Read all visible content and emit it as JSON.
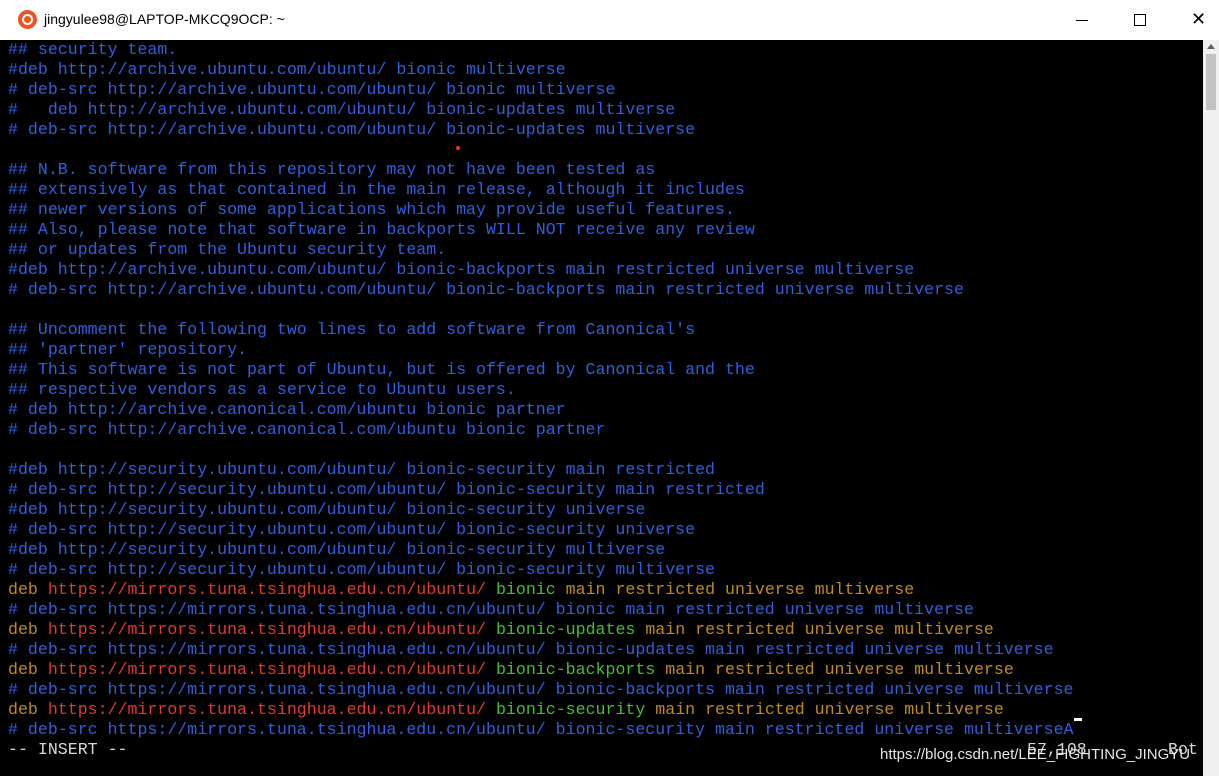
{
  "window": {
    "title": "jingyulee98@LAPTOP-MKCQ9OCP: ~",
    "icon": "ubuntu-icon",
    "controls": {
      "minimize": "minimize-icon",
      "maximize": "maximize-icon",
      "close": "close-icon"
    }
  },
  "colors": {
    "comment": "#2f5fe0",
    "keyword": "#c28a1c",
    "url": "#e33a2a",
    "suite": "#43c12f",
    "background": "#000000"
  },
  "lines": [
    [
      {
        "t": "## security team.",
        "c": "blue"
      }
    ],
    [
      {
        "t": "#deb http://archive.ubuntu.com/ubuntu/ bionic multiverse",
        "c": "blue"
      }
    ],
    [
      {
        "t": "# deb-src http://archive.ubuntu.com/ubuntu/ bionic multiverse",
        "c": "blue"
      }
    ],
    [
      {
        "t": "#   deb http://archive.ubuntu.com/ubuntu/ bionic-updates multiverse",
        "c": "blue"
      }
    ],
    [
      {
        "t": "# deb-src http://archive.ubuntu.com/ubuntu/ bionic-updates multiverse",
        "c": "blue"
      }
    ],
    [],
    [
      {
        "t": "## N.B. software from this repository may not have been tested as",
        "c": "blue"
      }
    ],
    [
      {
        "t": "## extensively as that contained in the main release, although it includes",
        "c": "blue"
      }
    ],
    [
      {
        "t": "## newer versions of some applications which may provide useful features.",
        "c": "blue"
      }
    ],
    [
      {
        "t": "## Also, please note that software in backports WILL NOT receive any review",
        "c": "blue"
      }
    ],
    [
      {
        "t": "## or updates from the Ubuntu security team.",
        "c": "blue"
      }
    ],
    [
      {
        "t": "#deb http://archive.ubuntu.com/ubuntu/ bionic-backports main restricted universe multiverse",
        "c": "blue"
      }
    ],
    [
      {
        "t": "# deb-src http://archive.ubuntu.com/ubuntu/ bionic-backports main restricted universe multiverse",
        "c": "blue"
      }
    ],
    [],
    [
      {
        "t": "## Uncomment the following two lines to add software from Canonical's",
        "c": "blue"
      }
    ],
    [
      {
        "t": "## 'partner' repository.",
        "c": "blue"
      }
    ],
    [
      {
        "t": "## This software is not part of Ubuntu, but is offered by Canonical and the",
        "c": "blue"
      }
    ],
    [
      {
        "t": "## respective vendors as a service to Ubuntu users.",
        "c": "blue"
      }
    ],
    [
      {
        "t": "# deb http://archive.canonical.com/ubuntu bionic partner",
        "c": "blue"
      }
    ],
    [
      {
        "t": "# deb-src http://archive.canonical.com/ubuntu bionic partner",
        "c": "blue"
      }
    ],
    [],
    [
      {
        "t": "#deb http://security.ubuntu.com/ubuntu/ bionic-security main restricted",
        "c": "blue"
      }
    ],
    [
      {
        "t": "# deb-src http://security.ubuntu.com/ubuntu/ bionic-security main restricted",
        "c": "blue"
      }
    ],
    [
      {
        "t": "#deb http://security.ubuntu.com/ubuntu/ bionic-security universe",
        "c": "blue"
      }
    ],
    [
      {
        "t": "# deb-src http://security.ubuntu.com/ubuntu/ bionic-security universe",
        "c": "blue"
      }
    ],
    [
      {
        "t": "#deb http://security.ubuntu.com/ubuntu/ bionic-security multiverse",
        "c": "blue"
      }
    ],
    [
      {
        "t": "# deb-src http://security.ubuntu.com/ubuntu/ bionic-security multiverse",
        "c": "blue"
      }
    ],
    [
      {
        "t": "deb ",
        "c": "brown"
      },
      {
        "t": "https://mirrors.tuna.tsinghua.edu.cn/ubuntu/",
        "c": "red"
      },
      {
        "t": " bionic",
        "c": "green"
      },
      {
        "t": " main restricted universe multiverse",
        "c": "brown"
      }
    ],
    [
      {
        "t": "# deb-src https://mirrors.tuna.tsinghua.edu.cn/ubuntu/ bionic main restricted universe multiverse",
        "c": "blue"
      }
    ],
    [
      {
        "t": "deb ",
        "c": "brown"
      },
      {
        "t": "https://mirrors.tuna.tsinghua.edu.cn/ubuntu/",
        "c": "red"
      },
      {
        "t": " bionic-updates",
        "c": "green"
      },
      {
        "t": " main restricted universe multiverse",
        "c": "brown"
      }
    ],
    [
      {
        "t": "# deb-src https://mirrors.tuna.tsinghua.edu.cn/ubuntu/ bionic-updates main restricted universe multiverse",
        "c": "blue"
      }
    ],
    [
      {
        "t": "deb ",
        "c": "brown"
      },
      {
        "t": "https://mirrors.tuna.tsinghua.edu.cn/ubuntu/",
        "c": "red"
      },
      {
        "t": " bionic-backports",
        "c": "green"
      },
      {
        "t": " main restricted universe multiverse",
        "c": "brown"
      }
    ],
    [
      {
        "t": "# deb-src https://mirrors.tuna.tsinghua.edu.cn/ubuntu/ bionic-backports main restricted universe multiverse",
        "c": "blue"
      }
    ],
    [
      {
        "t": "deb ",
        "c": "brown"
      },
      {
        "t": "https://mirrors.tuna.tsinghua.edu.cn/ubuntu/",
        "c": "red"
      },
      {
        "t": " bionic-security",
        "c": "green"
      },
      {
        "t": " main restricted universe multiverse",
        "c": "brown"
      }
    ],
    [
      {
        "t": "# deb-src https://mirrors.tuna.tsinghua.edu.cn/ubuntu/ bionic-security main restricted universe multiverseA",
        "c": "blue",
        "cursor": true
      }
    ]
  ],
  "status": {
    "mode": "-- INSERT --",
    "position": "57,108",
    "scroll": "Bot"
  },
  "watermark": "https://blog.csdn.net/LEE_FIGHTING_JINGYU"
}
